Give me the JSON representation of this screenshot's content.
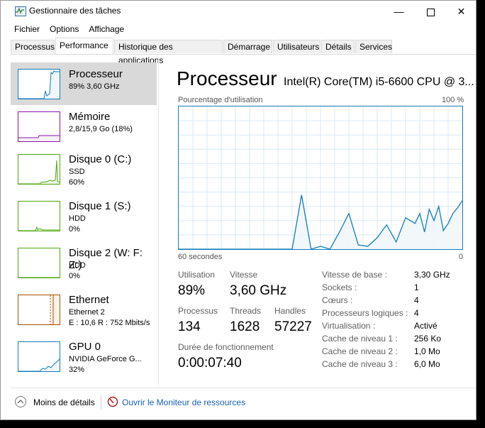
{
  "window": {
    "title": "Gestionnaire des tâches",
    "minimize": "—",
    "close": "✕"
  },
  "menu": [
    "Fichier",
    "Options",
    "Affichage"
  ],
  "tabs": [
    "Processus",
    "Performance",
    "Historique des applications",
    "Démarrage",
    "Utilisateurs",
    "Détails",
    "Services"
  ],
  "active_tab": "Performance",
  "sidebar": {
    "items": [
      {
        "name": "Processeur",
        "lines": [
          "89% 3,60 GHz"
        ],
        "color": "#117dbb",
        "fill": "#f1f6fa",
        "level": 0.89
      },
      {
        "name": "Mémoire",
        "lines": [
          "2,8/15,9 Go (18%)"
        ],
        "color": "#8b12ae",
        "fill": "#f4f2f4",
        "level": 0.18
      },
      {
        "name": "Disque 0 (C:)",
        "lines": [
          "SSD",
          "60%"
        ],
        "color": "#4da60c",
        "fill": "#eff7ea",
        "level": 0.6
      },
      {
        "name": "Disque 1 (S:)",
        "lines": [
          "HDD",
          "0%"
        ],
        "color": "#4da60c",
        "fill": "#eff7ea",
        "level": 0.0
      },
      {
        "name": "Disque 2 (W: F: Z:)",
        "lines": [
          "HDD",
          "0%"
        ],
        "color": "#4da60c",
        "fill": "#eff7ea",
        "level": 0.0
      },
      {
        "name": "Ethernet",
        "lines": [
          "Ethernet 2",
          "E : 10,6 R : 752 Mbits/s"
        ],
        "color": "#a74f01",
        "fill": "#fcf3eb",
        "level": 0.75
      },
      {
        "name": "GPU 0",
        "lines": [
          "NVIDIA GeForce G...",
          "32%"
        ],
        "color": "#117dbb",
        "fill": "#f1f6fa",
        "level": 0.32
      }
    ]
  },
  "main": {
    "title": "Processeur",
    "model": "Intel(R) Core(TM) i5-6600 CPU @ 3...",
    "graph_label_left": "Pourcentage d'utilisation",
    "graph_label_right": "100 %",
    "graph_time_left": "60 secondes",
    "graph_time_right": "0",
    "graph_color": "#117dbb",
    "graph_fill": "#f1f6fa",
    "graph_grid": "#d9eaf4"
  },
  "chart_data": {
    "type": "area",
    "title": "",
    "xlabel": "60 secondes",
    "ylabel": "Pourcentage d'utilisation",
    "xlim": [
      60,
      0
    ],
    "ylim": [
      0,
      100
    ],
    "x": [
      60,
      56,
      54,
      50,
      48,
      46,
      44,
      42,
      40,
      38,
      36,
      34,
      32,
      30,
      28,
      26,
      24,
      22,
      20,
      18,
      16,
      14,
      12,
      10,
      9,
      8,
      7,
      6,
      5,
      4,
      3,
      2,
      1,
      0
    ],
    "values": [
      0,
      0,
      0,
      0,
      0,
      0,
      0,
      0,
      0,
      0,
      0,
      38,
      0,
      2,
      0,
      12,
      25,
      3,
      2,
      8,
      17,
      5,
      22,
      18,
      25,
      12,
      28,
      20,
      30,
      13,
      18,
      25,
      29,
      34
    ],
    "grid": true
  },
  "stats": {
    "utilisation_label": "Utilisation",
    "utilisation_value": "89%",
    "vitesse_label": "Vitesse",
    "vitesse_value": "3,60 GHz",
    "processus_label": "Processus",
    "processus_value": "134",
    "threads_label": "Threads",
    "threads_value": "1628",
    "handles_label": "Handles",
    "handles_value": "57227",
    "uptime_label": "Durée de fonctionnement",
    "uptime_value": "0:00:07:40"
  },
  "details": [
    {
      "label": "Vitesse de base :",
      "value": "3,30 GHz"
    },
    {
      "label": "Sockets :",
      "value": "1"
    },
    {
      "label": "Cœurs :",
      "value": "4"
    },
    {
      "label": "Processeurs logiques :",
      "value": "4"
    },
    {
      "label": "Virtualisation :",
      "value": "Activé"
    },
    {
      "label": "Cache de niveau 1 :",
      "value": "256 Ko"
    },
    {
      "label": "Cache de niveau 2 :",
      "value": "1,0 Mo"
    },
    {
      "label": "Cache de niveau 3 :",
      "value": "6,0 Mo"
    }
  ],
  "footer": {
    "less_details": "Moins de détails",
    "resource_monitor": "Ouvrir le Moniteur de ressources"
  }
}
